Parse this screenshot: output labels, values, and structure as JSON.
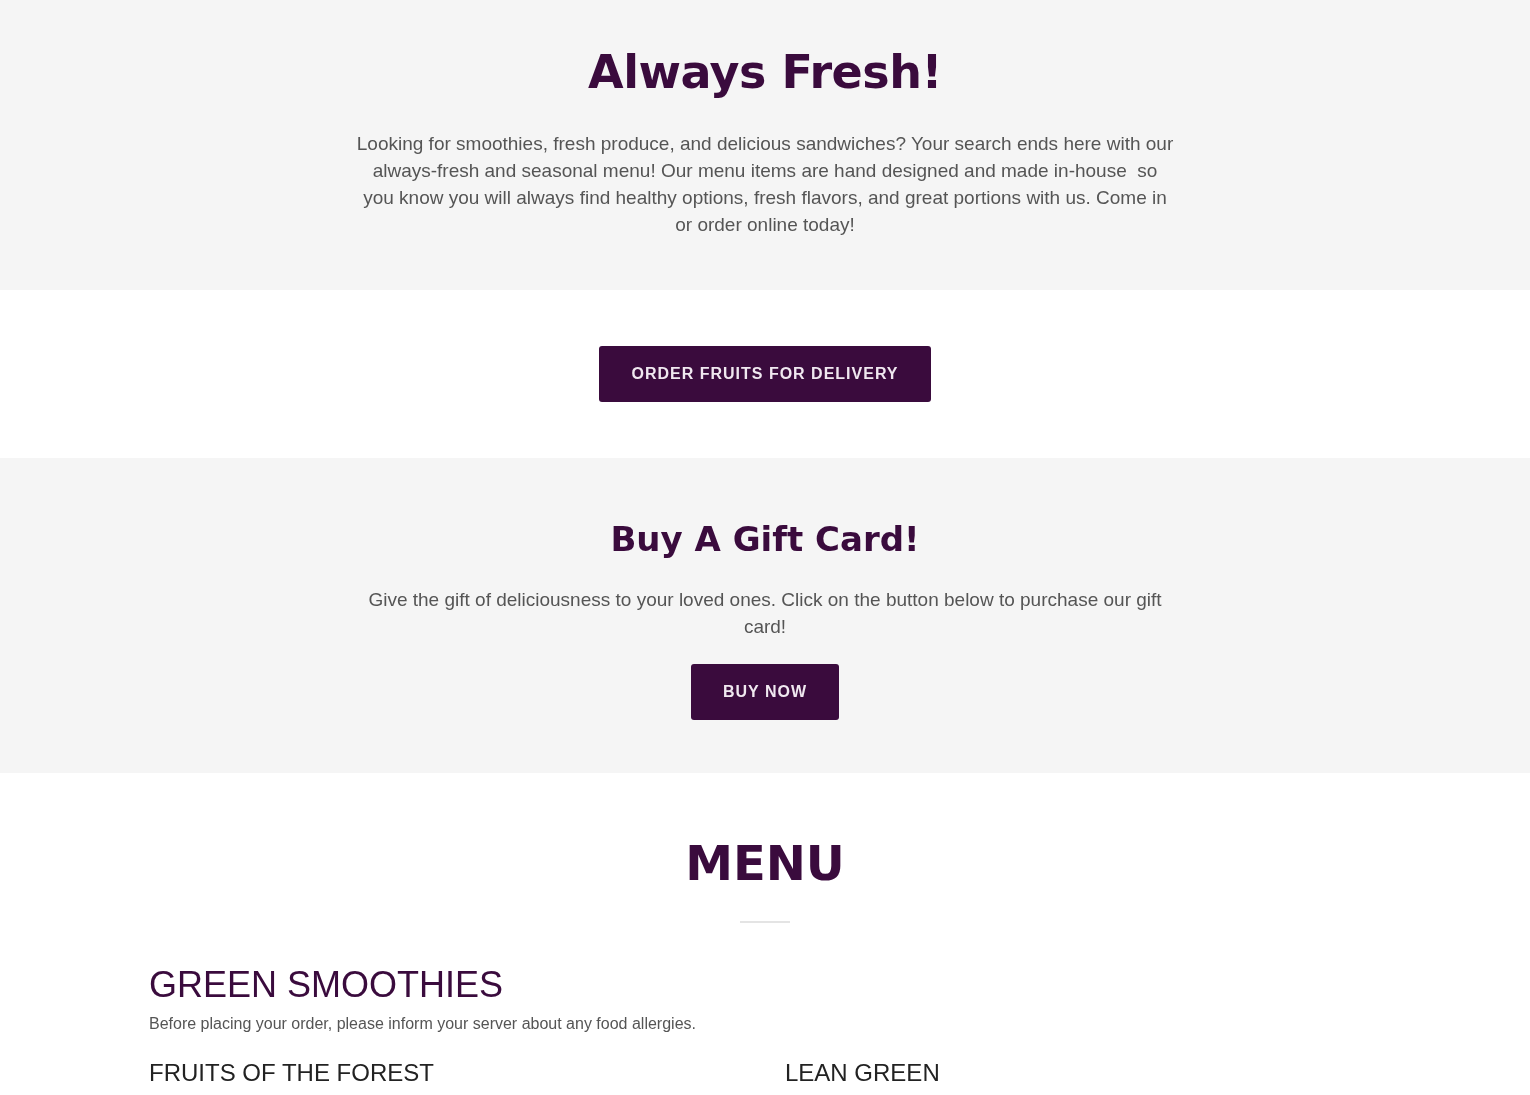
{
  "hero": {
    "title": "Always Fresh!",
    "text": "Looking for smoothies, fresh produce, and delicious sandwiches? Your search ends here with our always-fresh and seasonal menu! Our menu items are hand designed and made in-house  so you know you will always find healthy options, fresh flavors, and great portions with us. Come in or order online today!"
  },
  "delivery": {
    "button": "ORDER FRUITS FOR DELIVERY"
  },
  "gift_card": {
    "title": "Buy A Gift Card!",
    "text": "Give the gift of deliciousness to your loved ones. Click on the button below to purchase our gift card!",
    "button": "BUY NOW"
  },
  "menu": {
    "title": "MENU",
    "category": {
      "title": "GREEN SMOOTHIES",
      "note": "Before placing your order, please inform your server about any food allergies.",
      "items": [
        {
          "name": "FRUITS OF THE FOREST"
        },
        {
          "name": "LEAN GREEN"
        }
      ]
    }
  }
}
